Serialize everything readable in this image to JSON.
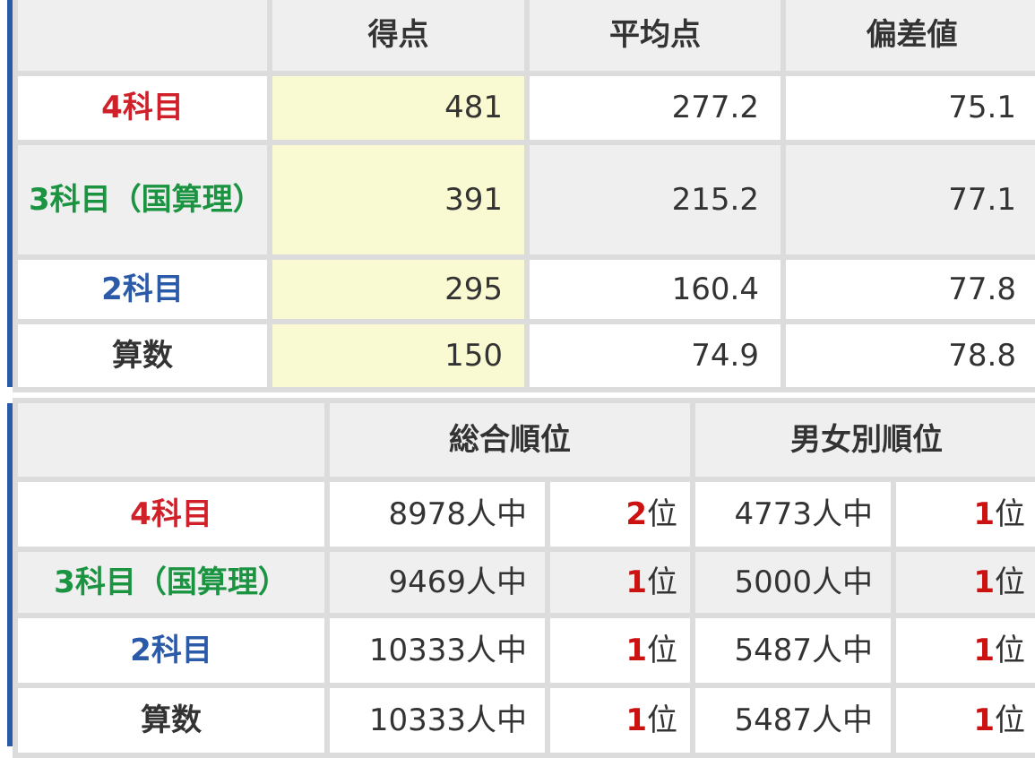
{
  "scores": {
    "headers": [
      "",
      "得点",
      "平均点",
      "偏差値"
    ],
    "rows": [
      {
        "label": "4科目",
        "score": "481",
        "average": "277.2",
        "deviation": "75.1"
      },
      {
        "label": "3科目（国算理）",
        "score": "391",
        "average": "215.2",
        "deviation": "77.1"
      },
      {
        "label": "2科目",
        "score": "295",
        "average": "160.4",
        "deviation": "77.8"
      },
      {
        "label": "算数",
        "score": "150",
        "average": "74.9",
        "deviation": "78.8"
      }
    ]
  },
  "ranks": {
    "headers": [
      "",
      "総合順位",
      "男女別順位"
    ],
    "rank_suffix": "位",
    "rows": [
      {
        "label": "4科目",
        "overall_total": "8978人中",
        "overall_rank": "2",
        "gender_total": "4773人中",
        "gender_rank": "1"
      },
      {
        "label": "3科目（国算理）",
        "overall_total": "9469人中",
        "overall_rank": "1",
        "gender_total": "5000人中",
        "gender_rank": "1"
      },
      {
        "label": "2科目",
        "overall_total": "10333人中",
        "overall_rank": "1",
        "gender_total": "5487人中",
        "gender_rank": "1"
      },
      {
        "label": "算数",
        "overall_total": "10333人中",
        "overall_rank": "1",
        "gender_total": "5487人中",
        "gender_rank": "1"
      }
    ]
  },
  "colors": {
    "four_subjects": "#d0202a",
    "three_subjects": "#1a9440",
    "two_subjects": "#2b5aa8",
    "math": "#333333",
    "rank_highlight": "#cc1111",
    "score_column_bg": "#fafad2",
    "header_bg": "#efefef",
    "accent_bar": "#2b5aa8"
  }
}
